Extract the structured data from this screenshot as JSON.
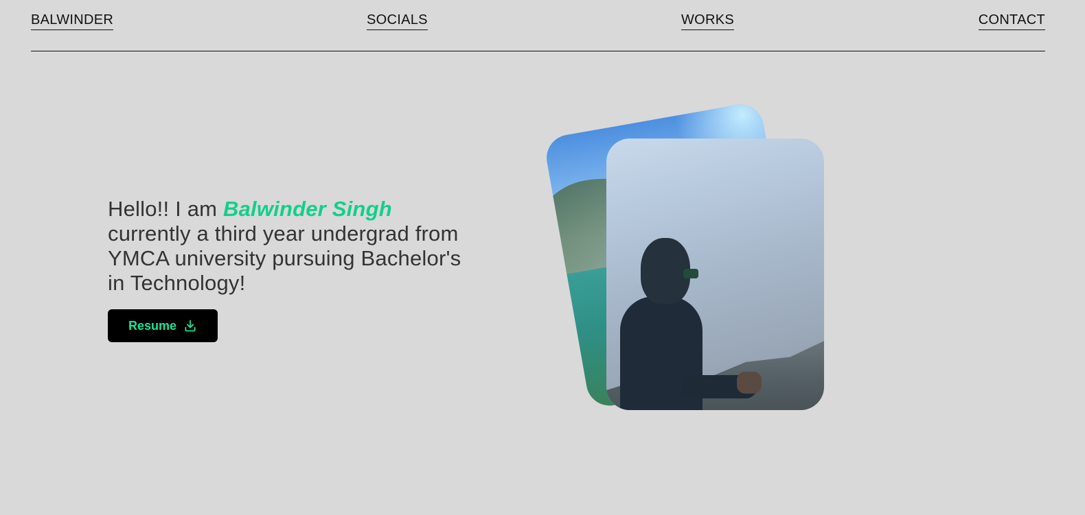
{
  "nav": {
    "brand": "BALWINDER",
    "socials": "SOCIALS",
    "works": "WORKS",
    "contact": "CONTACT"
  },
  "hero": {
    "greeting": "Hello!! I am ",
    "name": "Balwinder Singh",
    "description": "currently a third year undergrad from YMCA university pursuing Bachelor's in Technology!",
    "resume_label": "Resume",
    "resume_icon": "download-icon"
  },
  "colors": {
    "background": "#d9d9d9",
    "accent": "#12cf8a",
    "button_bg": "#000000",
    "button_text": "#18e59a"
  }
}
